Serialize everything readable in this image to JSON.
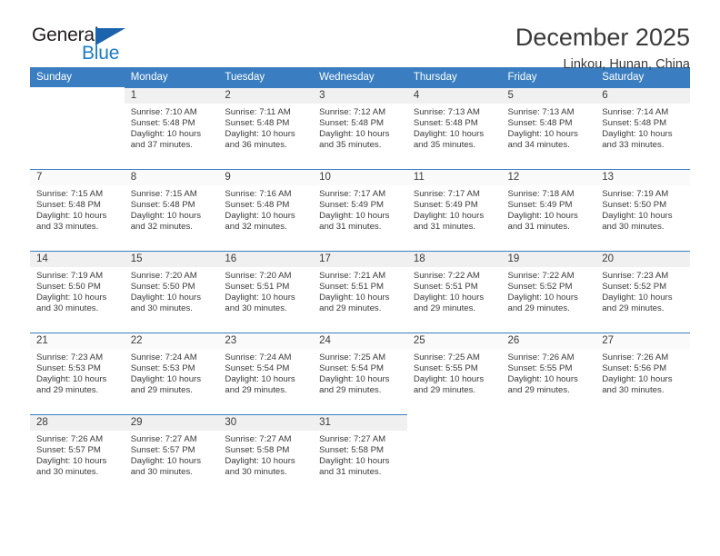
{
  "logo": {
    "text_top": "General",
    "text_bottom": "Blue",
    "icon": "triangle-icon",
    "color_dark": "#231f20",
    "color_blue": "#1b7cc4"
  },
  "header": {
    "title": "December 2025",
    "subtitle": "Linkou, Hunan, China"
  },
  "calendar": {
    "accent_color": "#3a7ec1",
    "weekday_headers": [
      "Sunday",
      "Monday",
      "Tuesday",
      "Wednesday",
      "Thursday",
      "Friday",
      "Saturday"
    ],
    "weeks": [
      [
        {
          "day": "",
          "sunrise": "",
          "sunset": "",
          "daylight_line1": "",
          "daylight_line2": ""
        },
        {
          "day": "1",
          "sunrise": "Sunrise: 7:10 AM",
          "sunset": "Sunset: 5:48 PM",
          "daylight_line1": "Daylight: 10 hours",
          "daylight_line2": "and 37 minutes."
        },
        {
          "day": "2",
          "sunrise": "Sunrise: 7:11 AM",
          "sunset": "Sunset: 5:48 PM",
          "daylight_line1": "Daylight: 10 hours",
          "daylight_line2": "and 36 minutes."
        },
        {
          "day": "3",
          "sunrise": "Sunrise: 7:12 AM",
          "sunset": "Sunset: 5:48 PM",
          "daylight_line1": "Daylight: 10 hours",
          "daylight_line2": "and 35 minutes."
        },
        {
          "day": "4",
          "sunrise": "Sunrise: 7:13 AM",
          "sunset": "Sunset: 5:48 PM",
          "daylight_line1": "Daylight: 10 hours",
          "daylight_line2": "and 35 minutes."
        },
        {
          "day": "5",
          "sunrise": "Sunrise: 7:13 AM",
          "sunset": "Sunset: 5:48 PM",
          "daylight_line1": "Daylight: 10 hours",
          "daylight_line2": "and 34 minutes."
        },
        {
          "day": "6",
          "sunrise": "Sunrise: 7:14 AM",
          "sunset": "Sunset: 5:48 PM",
          "daylight_line1": "Daylight: 10 hours",
          "daylight_line2": "and 33 minutes."
        }
      ],
      [
        {
          "day": "7",
          "sunrise": "Sunrise: 7:15 AM",
          "sunset": "Sunset: 5:48 PM",
          "daylight_line1": "Daylight: 10 hours",
          "daylight_line2": "and 33 minutes."
        },
        {
          "day": "8",
          "sunrise": "Sunrise: 7:15 AM",
          "sunset": "Sunset: 5:48 PM",
          "daylight_line1": "Daylight: 10 hours",
          "daylight_line2": "and 32 minutes."
        },
        {
          "day": "9",
          "sunrise": "Sunrise: 7:16 AM",
          "sunset": "Sunset: 5:48 PM",
          "daylight_line1": "Daylight: 10 hours",
          "daylight_line2": "and 32 minutes."
        },
        {
          "day": "10",
          "sunrise": "Sunrise: 7:17 AM",
          "sunset": "Sunset: 5:49 PM",
          "daylight_line1": "Daylight: 10 hours",
          "daylight_line2": "and 31 minutes."
        },
        {
          "day": "11",
          "sunrise": "Sunrise: 7:17 AM",
          "sunset": "Sunset: 5:49 PM",
          "daylight_line1": "Daylight: 10 hours",
          "daylight_line2": "and 31 minutes."
        },
        {
          "day": "12",
          "sunrise": "Sunrise: 7:18 AM",
          "sunset": "Sunset: 5:49 PM",
          "daylight_line1": "Daylight: 10 hours",
          "daylight_line2": "and 31 minutes."
        },
        {
          "day": "13",
          "sunrise": "Sunrise: 7:19 AM",
          "sunset": "Sunset: 5:50 PM",
          "daylight_line1": "Daylight: 10 hours",
          "daylight_line2": "and 30 minutes."
        }
      ],
      [
        {
          "day": "14",
          "sunrise": "Sunrise: 7:19 AM",
          "sunset": "Sunset: 5:50 PM",
          "daylight_line1": "Daylight: 10 hours",
          "daylight_line2": "and 30 minutes."
        },
        {
          "day": "15",
          "sunrise": "Sunrise: 7:20 AM",
          "sunset": "Sunset: 5:50 PM",
          "daylight_line1": "Daylight: 10 hours",
          "daylight_line2": "and 30 minutes."
        },
        {
          "day": "16",
          "sunrise": "Sunrise: 7:20 AM",
          "sunset": "Sunset: 5:51 PM",
          "daylight_line1": "Daylight: 10 hours",
          "daylight_line2": "and 30 minutes."
        },
        {
          "day": "17",
          "sunrise": "Sunrise: 7:21 AM",
          "sunset": "Sunset: 5:51 PM",
          "daylight_line1": "Daylight: 10 hours",
          "daylight_line2": "and 29 minutes."
        },
        {
          "day": "18",
          "sunrise": "Sunrise: 7:22 AM",
          "sunset": "Sunset: 5:51 PM",
          "daylight_line1": "Daylight: 10 hours",
          "daylight_line2": "and 29 minutes."
        },
        {
          "day": "19",
          "sunrise": "Sunrise: 7:22 AM",
          "sunset": "Sunset: 5:52 PM",
          "daylight_line1": "Daylight: 10 hours",
          "daylight_line2": "and 29 minutes."
        },
        {
          "day": "20",
          "sunrise": "Sunrise: 7:23 AM",
          "sunset": "Sunset: 5:52 PM",
          "daylight_line1": "Daylight: 10 hours",
          "daylight_line2": "and 29 minutes."
        }
      ],
      [
        {
          "day": "21",
          "sunrise": "Sunrise: 7:23 AM",
          "sunset": "Sunset: 5:53 PM",
          "daylight_line1": "Daylight: 10 hours",
          "daylight_line2": "and 29 minutes."
        },
        {
          "day": "22",
          "sunrise": "Sunrise: 7:24 AM",
          "sunset": "Sunset: 5:53 PM",
          "daylight_line1": "Daylight: 10 hours",
          "daylight_line2": "and 29 minutes."
        },
        {
          "day": "23",
          "sunrise": "Sunrise: 7:24 AM",
          "sunset": "Sunset: 5:54 PM",
          "daylight_line1": "Daylight: 10 hours",
          "daylight_line2": "and 29 minutes."
        },
        {
          "day": "24",
          "sunrise": "Sunrise: 7:25 AM",
          "sunset": "Sunset: 5:54 PM",
          "daylight_line1": "Daylight: 10 hours",
          "daylight_line2": "and 29 minutes."
        },
        {
          "day": "25",
          "sunrise": "Sunrise: 7:25 AM",
          "sunset": "Sunset: 5:55 PM",
          "daylight_line1": "Daylight: 10 hours",
          "daylight_line2": "and 29 minutes."
        },
        {
          "day": "26",
          "sunrise": "Sunrise: 7:26 AM",
          "sunset": "Sunset: 5:55 PM",
          "daylight_line1": "Daylight: 10 hours",
          "daylight_line2": "and 29 minutes."
        },
        {
          "day": "27",
          "sunrise": "Sunrise: 7:26 AM",
          "sunset": "Sunset: 5:56 PM",
          "daylight_line1": "Daylight: 10 hours",
          "daylight_line2": "and 30 minutes."
        }
      ],
      [
        {
          "day": "28",
          "sunrise": "Sunrise: 7:26 AM",
          "sunset": "Sunset: 5:57 PM",
          "daylight_line1": "Daylight: 10 hours",
          "daylight_line2": "and 30 minutes."
        },
        {
          "day": "29",
          "sunrise": "Sunrise: 7:27 AM",
          "sunset": "Sunset: 5:57 PM",
          "daylight_line1": "Daylight: 10 hours",
          "daylight_line2": "and 30 minutes."
        },
        {
          "day": "30",
          "sunrise": "Sunrise: 7:27 AM",
          "sunset": "Sunset: 5:58 PM",
          "daylight_line1": "Daylight: 10 hours",
          "daylight_line2": "and 30 minutes."
        },
        {
          "day": "31",
          "sunrise": "Sunrise: 7:27 AM",
          "sunset": "Sunset: 5:58 PM",
          "daylight_line1": "Daylight: 10 hours",
          "daylight_line2": "and 31 minutes."
        },
        {
          "day": "",
          "sunrise": "",
          "sunset": "",
          "daylight_line1": "",
          "daylight_line2": ""
        },
        {
          "day": "",
          "sunrise": "",
          "sunset": "",
          "daylight_line1": "",
          "daylight_line2": ""
        },
        {
          "day": "",
          "sunrise": "",
          "sunset": "",
          "daylight_line1": "",
          "daylight_line2": ""
        }
      ]
    ]
  }
}
